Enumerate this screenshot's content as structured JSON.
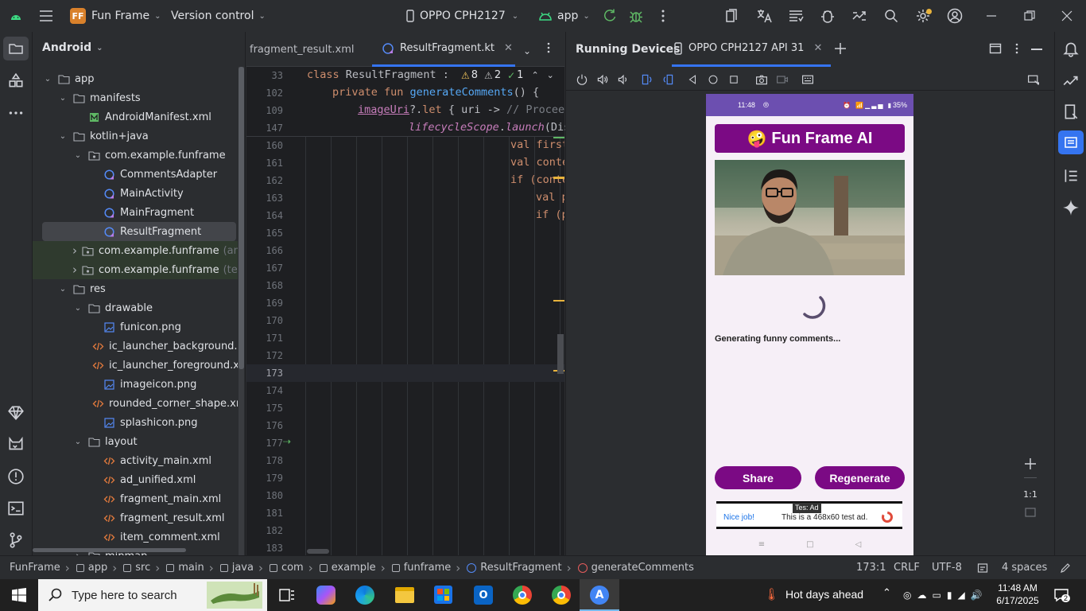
{
  "titlebar": {
    "project_badge": "FF",
    "project_name": "Fun Frame",
    "vcs": "Version control",
    "device": "OPPO CPH2127",
    "run_config": "app"
  },
  "project_panel": {
    "title": "Android",
    "tree": [
      {
        "label": "app",
        "depth": 0,
        "expanded": true,
        "icon": "folder-icon"
      },
      {
        "label": "manifests",
        "depth": 1,
        "expanded": true,
        "icon": "folder-icon"
      },
      {
        "label": "AndroidManifest.xml",
        "depth": 2,
        "icon": "manifest-icon"
      },
      {
        "label": "kotlin+java",
        "depth": 1,
        "expanded": true,
        "icon": "folder-icon"
      },
      {
        "label": "com.example.funframe",
        "depth": 2,
        "expanded": true,
        "icon": "package-icon"
      },
      {
        "label": "CommentsAdapter",
        "depth": 3,
        "icon": "kotlin-class-icon"
      },
      {
        "label": "MainActivity",
        "depth": 3,
        "icon": "kotlin-class-icon"
      },
      {
        "label": "MainFragment",
        "depth": 3,
        "icon": "kotlin-class-icon"
      },
      {
        "label": "ResultFragment",
        "depth": 3,
        "icon": "kotlin-class-icon",
        "selected": true
      },
      {
        "label": "com.example.funframe",
        "suffix": "(andr",
        "depth": 2,
        "expanded": false,
        "icon": "package-icon",
        "test": true
      },
      {
        "label": "com.example.funframe",
        "suffix": "(test",
        "depth": 2,
        "expanded": false,
        "icon": "package-icon",
        "test": true
      },
      {
        "label": "res",
        "depth": 1,
        "expanded": true,
        "icon": "folder-icon"
      },
      {
        "label": "drawable",
        "depth": 2,
        "expanded": true,
        "icon": "folder-icon"
      },
      {
        "label": "funicon.png",
        "depth": 3,
        "icon": "image-icon"
      },
      {
        "label": "ic_launcher_background.x",
        "depth": 3,
        "icon": "xml-icon"
      },
      {
        "label": "ic_launcher_foreground.x",
        "depth": 3,
        "icon": "xml-icon"
      },
      {
        "label": "imageicon.png",
        "depth": 3,
        "icon": "image-icon"
      },
      {
        "label": "rounded_corner_shape.xr",
        "depth": 3,
        "icon": "xml-icon"
      },
      {
        "label": "splashicon.png",
        "depth": 3,
        "icon": "image-icon"
      },
      {
        "label": "layout",
        "depth": 2,
        "expanded": true,
        "icon": "folder-icon"
      },
      {
        "label": "activity_main.xml",
        "depth": 3,
        "icon": "xml-icon"
      },
      {
        "label": "ad_unified.xml",
        "depth": 3,
        "icon": "xml-icon"
      },
      {
        "label": "fragment_main.xml",
        "depth": 3,
        "icon": "xml-icon"
      },
      {
        "label": "fragment_result.xml",
        "depth": 3,
        "icon": "xml-icon"
      },
      {
        "label": "item_comment.xml",
        "depth": 3,
        "icon": "xml-icon"
      },
      {
        "label": "mipmap",
        "depth": 2,
        "expanded": false,
        "icon": "folder-icon"
      }
    ]
  },
  "editor": {
    "tabs": [
      {
        "label": "fragment_result.xml",
        "active": false
      },
      {
        "label": "ResultFragment.kt",
        "active": true
      }
    ],
    "warnings": "8",
    "weak_warnings": "2",
    "typos": "1",
    "sticky_lines": [
      {
        "num": "33",
        "indent": 0,
        "parts": [
          [
            "class ",
            "kw"
          ],
          [
            "ResultFragment",
            "plain"
          ],
          [
            " :",
            "plain"
          ]
        ]
      },
      {
        "num": "102",
        "indent": 1,
        "parts": [
          [
            "private fun ",
            "kw"
          ],
          [
            "generateComments",
            "fn"
          ],
          [
            "() {",
            "plain"
          ]
        ]
      },
      {
        "num": "109",
        "indent": 2,
        "parts": [
          [
            "imageUri",
            "ul"
          ],
          [
            "?.",
            "plain"
          ],
          [
            "let",
            "kw"
          ],
          [
            " { uri -> ",
            "plain"
          ],
          [
            "// Proceed",
            "cm"
          ]
        ]
      },
      {
        "num": "147",
        "indent": 4,
        "parts": [
          [
            "lifecycleScope",
            "it"
          ],
          [
            ".",
            "plain"
          ],
          [
            "launch",
            "it"
          ],
          [
            "(Dis",
            "plain"
          ]
        ]
      }
    ],
    "lines": [
      {
        "num": "160",
        "text": "val first",
        "indent": 8
      },
      {
        "num": "161",
        "text": "val conte",
        "indent": 8
      },
      {
        "num": "162",
        "text": "if (conte",
        "indent": 8
      },
      {
        "num": "163",
        "text": "val p",
        "indent": 9
      },
      {
        "num": "164",
        "text": "if (p",
        "indent": 9
      },
      {
        "num": "165",
        "text": "",
        "indent": 10
      },
      {
        "num": "166",
        "text": "",
        "indent": 10
      },
      {
        "num": "167",
        "text": "",
        "indent": 10
      },
      {
        "num": "168",
        "text": "",
        "indent": 0
      },
      {
        "num": "169",
        "text": "",
        "indent": 0
      },
      {
        "num": "170",
        "text": "",
        "indent": 0
      },
      {
        "num": "171",
        "text": "",
        "indent": 0
      },
      {
        "num": "172",
        "text": "",
        "indent": 0
      },
      {
        "num": "173",
        "text": "",
        "indent": 0,
        "current": true
      },
      {
        "num": "174",
        "text": "",
        "indent": 0
      },
      {
        "num": "175",
        "text": "",
        "indent": 0
      },
      {
        "num": "176",
        "text": "",
        "indent": 0
      },
      {
        "num": "177",
        "text": "",
        "indent": 0
      },
      {
        "num": "178",
        "text": "",
        "indent": 0
      },
      {
        "num": "179",
        "text": "",
        "indent": 0
      },
      {
        "num": "180",
        "text": "",
        "indent": 0
      },
      {
        "num": "181",
        "text": "",
        "indent": 0
      },
      {
        "num": "182",
        "text": "",
        "indent": 0
      },
      {
        "num": "183",
        "text": "",
        "indent": 0
      }
    ]
  },
  "running_devices": {
    "title": "Running Devices",
    "tab": "OPPO CPH2127 API 31",
    "zoom_label": "1:1"
  },
  "phone": {
    "time": "11:48",
    "battery": "35%",
    "header_emoji": "🤪",
    "header_title": "Fun Frame AI",
    "loading_text": "Generating funny comments...",
    "share_label": "Share",
    "regenerate_label": "Regenerate",
    "ad_badge": "Tes: Ad",
    "ad_left": "Nice job!",
    "ad_text": "This is a 468x60 test ad.",
    "accent": "#7b0a84",
    "background": "#f6eff7"
  },
  "statusbar": {
    "breadcrumbs": [
      "FunFrame",
      "app",
      "src",
      "main",
      "java",
      "com",
      "example",
      "funframe",
      "ResultFragment",
      "generateComments"
    ],
    "position": "173:1",
    "line_sep": "CRLF",
    "encoding": "UTF-8",
    "indent": "4 spaces"
  },
  "taskbar": {
    "search_placeholder": "Type here to search",
    "weather": "Hot days ahead",
    "time": "11:48 AM",
    "date": "6/17/2025",
    "notifications": "2"
  }
}
